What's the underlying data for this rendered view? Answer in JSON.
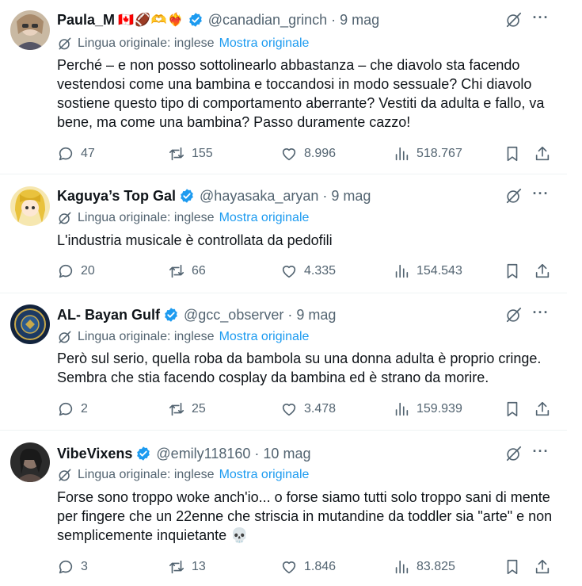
{
  "tweets": [
    {
      "name": "Paula_M",
      "emojis": "🇨🇦🏈🫶❤️‍🔥",
      "verified": true,
      "handle": "@canadian_grinch",
      "time": "9 mag",
      "translation_note": "Lingua originale: inglese",
      "translation_link": "Mostra originale",
      "text": "Perché – e non posso sottolinearlo abbastanza – che diavolo sta facendo vestendosi come una bambina e toccandosi in modo sessuale? Chi diavolo sostiene questo tipo di comportamento aberrante? Vestiti da adulta e fallo, va bene, ma come una bambina? Passo duramente cazzo!",
      "replies": "47",
      "reposts": "155",
      "likes": "8.996",
      "views": "518.767"
    },
    {
      "name": "Kaguya’s Top Gal",
      "emojis": "",
      "verified": true,
      "handle": "@hayasaka_aryan",
      "time": "9 mag",
      "translation_note": "Lingua originale: inglese",
      "translation_link": "Mostra originale",
      "text": "L'industria musicale è controllata da pedofili",
      "replies": "20",
      "reposts": "66",
      "likes": "4.335",
      "views": "154.543"
    },
    {
      "name": "AL- Bayan Gulf",
      "emojis": "",
      "verified": true,
      "handle": "@gcc_observer",
      "time": "9 mag",
      "translation_note": "Lingua originale: inglese",
      "translation_link": "Mostra originale",
      "text": "Però sul serio, quella roba da bambola su una donna adulta è proprio cringe. Sembra che stia facendo cosplay da bambina ed è strano da morire.",
      "replies": "2",
      "reposts": "25",
      "likes": "3.478",
      "views": "159.939"
    },
    {
      "name": "VibeVixens",
      "emojis": "",
      "verified": true,
      "handle": "@emily118160",
      "time": "10 mag",
      "translation_note": "Lingua originale: inglese",
      "translation_link": "Mostra originale",
      "text": "Forse sono troppo woke anch'io... o forse siamo tutti solo troppo sani di mente per fingere che un 22enne che striscia in mutandine da toddler sia \"arte\" e non semplicemente inquietante 💀",
      "replies": "3",
      "reposts": "13",
      "likes": "1.846",
      "views": "83.825"
    }
  ],
  "colors": {
    "accent": "#1d9bf0",
    "secondary_text": "#536471",
    "primary_text": "#0f1419",
    "divider": "#eff3f4"
  },
  "icons": [
    "verified-badge-icon",
    "translate-icon",
    "grok-icon",
    "more-icon",
    "reply-icon",
    "repost-icon",
    "like-icon",
    "views-icon",
    "bookmark-icon",
    "share-icon"
  ]
}
